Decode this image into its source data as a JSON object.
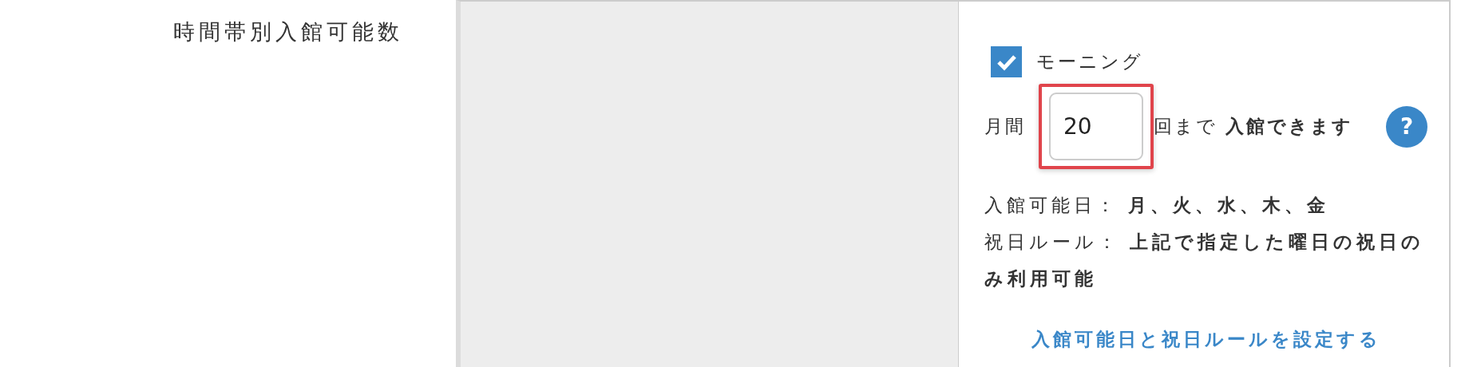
{
  "field_label": "時間帯別入館可能数",
  "slot": {
    "name": "モーニング",
    "checked": true,
    "prefix": "月間",
    "value": "20",
    "highlighted": true,
    "suffix": "回まで",
    "suffix_bold": "入館できます",
    "help": "?"
  },
  "details": [
    "入館可能日： **月、火、水、木、金**",
    "祝日ルール： **上記で指定した曜日の祝日のみ利用可能**"
  ],
  "link": "入館可能日と祝日ルールを設定する"
}
